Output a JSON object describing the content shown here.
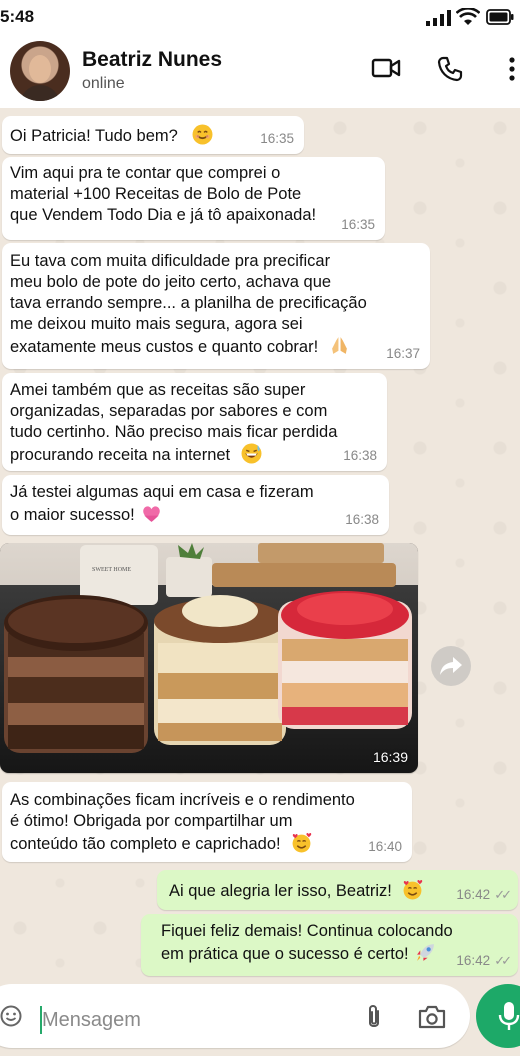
{
  "status_bar": {
    "time": "5:48"
  },
  "header": {
    "contact_name": "Beatriz Nunes",
    "status": "online"
  },
  "messages": [
    {
      "text": "Oi Patricia! Tudo bem?",
      "time": "16:35"
    },
    {
      "text": "Vim aqui pra te contar que comprei o\nmaterial +100 Receitas de Bolo de Pote\nque Vendem Todo Dia e já tô apaixonada!",
      "time": "16:35"
    },
    {
      "text": "Eu tava com muita dificuldade pra precificar\nmeu bolo de pote do jeito certo, achava que\ntava errando sempre... a planilha de precificação\nme deixou muito mais segura, agora sei\nexatamente meus custos e quanto cobrar!",
      "time": "16:37"
    },
    {
      "text": "Amei também que as receitas são super\norganizadas, separadas por sabores e com\ntudo certinho. Não preciso mais ficar perdida\nprocurando receita na internet",
      "time": "16:38"
    },
    {
      "text": "Já testei algumas aqui em casa e fizeram\no maior sucesso!",
      "time": "16:38"
    },
    {
      "text": "As combinações ficam incríveis e o rendimento\né ótimo! Obrigada por compartilhar um\nconteúdo tão completo e caprichado!",
      "time": "16:40"
    },
    {
      "text": "Ai que alegria ler isso, Beatriz!",
      "time": "16:42"
    },
    {
      "text": "Fiquei feliz demais! Continua colocando\nem prática que o sucesso é certo!",
      "time": "16:42"
    }
  ],
  "photo_message": {
    "time": "16:39",
    "jar_label": "SWEET HOME"
  },
  "input": {
    "placeholder": "Mensagem"
  },
  "colors": {
    "accent": "#1da968",
    "outgoing_bubble": "#dcf8c6",
    "chat_bg": "#efe7dd"
  }
}
